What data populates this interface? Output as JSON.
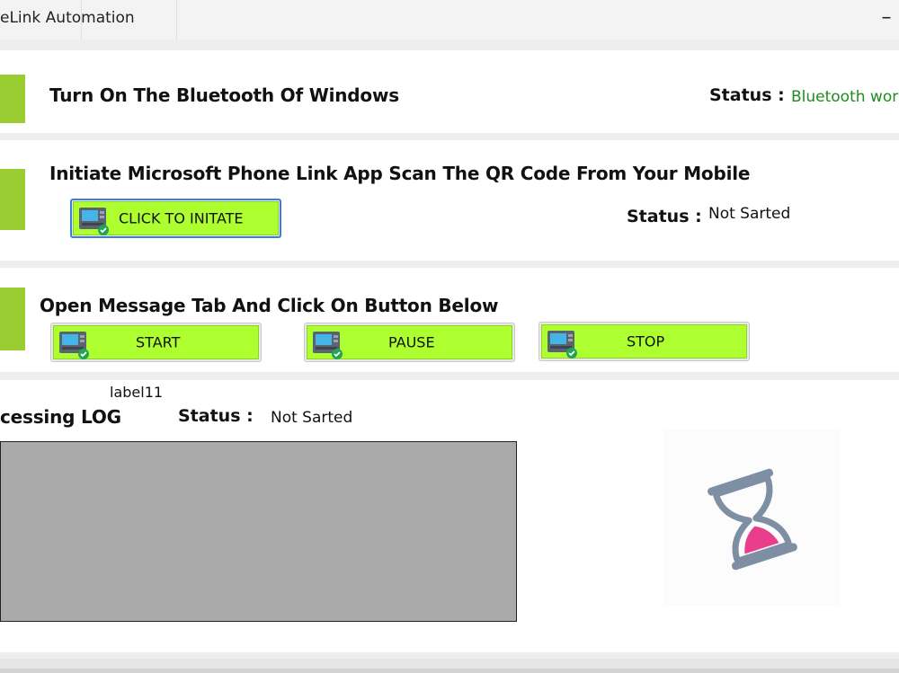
{
  "window": {
    "title": "eLink Automation",
    "minimize_glyph": "–"
  },
  "section1": {
    "heading": "Turn On The Bluetooth Of Windows",
    "status_label": "Status :",
    "status_value": "Bluetooth worki"
  },
  "section2": {
    "heading": "Initiate Microsoft Phone Link App  Scan The QR Code From Your Mobile",
    "button_label": "CLICK TO INITATE",
    "status_label": "Status :",
    "status_value": "Not Sarted"
  },
  "section3": {
    "heading": "Open Message Tab And Click On Button Below",
    "buttons": [
      {
        "label": "START"
      },
      {
        "label": "PAUSE"
      },
      {
        "label": "STOP"
      }
    ]
  },
  "section4": {
    "label11": "label11",
    "heading": "cessing LOG",
    "status_label": "Status :",
    "status_value": "Not Sarted"
  },
  "colors": {
    "accent_marker": "#9acd32",
    "button_face": "#adff2f",
    "status_ok": "#1e8c1e",
    "log_box": "#aaaaaa"
  },
  "icons": {
    "button_icon": "atm-check-icon",
    "busy_icon": "hourglass-icon"
  }
}
